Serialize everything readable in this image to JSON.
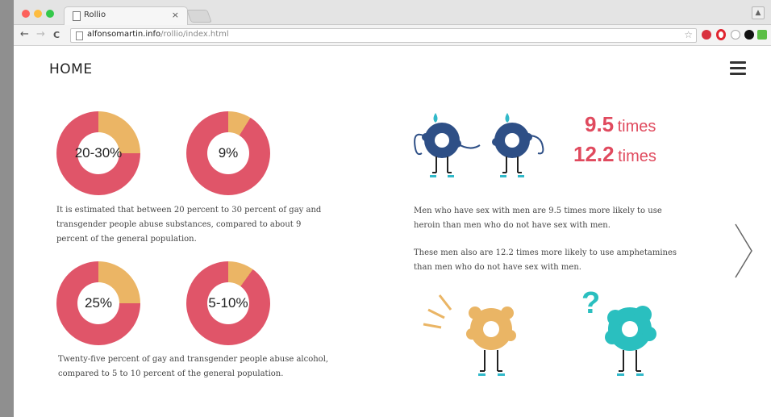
{
  "browser": {
    "tab_title": "Rollio",
    "tab_close": "×",
    "url_domain": "alfonsomartin.info",
    "url_path": "/rollio/index.html",
    "back": "←",
    "forward": "→",
    "reload": "C"
  },
  "header": {
    "home_label": "HOME"
  },
  "donuts": [
    {
      "label": "20-30%",
      "accent_fraction": 0.25
    },
    {
      "label": "9%",
      "accent_fraction": 0.09
    },
    {
      "label": "25%",
      "accent_fraction": 0.25
    },
    {
      "label": "5-10%",
      "accent_fraction": 0.1
    }
  ],
  "paragraphs": {
    "substances": "It is estimated that between 20 percent to 30 percent of gay and transgender people abuse substances, compared to about 9 percent of the general population.",
    "alcohol": "Twenty-five percent of gay and transgender people abuse alcohol, compared to 5 to 10 percent of the general population.",
    "heroin": "Men who have sex with men are 9.5 times more likely to use heroin than men who do not have sex with men.",
    "amphetamines": "These men also are 12.2 times more likely to use amphetamines than men who do not have sex with men."
  },
  "stats": [
    {
      "value": "9.5",
      "unit": "times"
    },
    {
      "value": "12.2",
      "unit": "times"
    }
  ],
  "colors": {
    "donut_primary": "#e05569",
    "donut_accent": "#ebb565",
    "stat_color": "#e04a5e",
    "figure_navy": "#2e4f86",
    "figure_yellow": "#eab565",
    "figure_teal": "#2abfbf"
  },
  "icons": {
    "menu": "hamburger-menu-icon",
    "next": "chevron-right-icon",
    "question": "question-mark"
  }
}
